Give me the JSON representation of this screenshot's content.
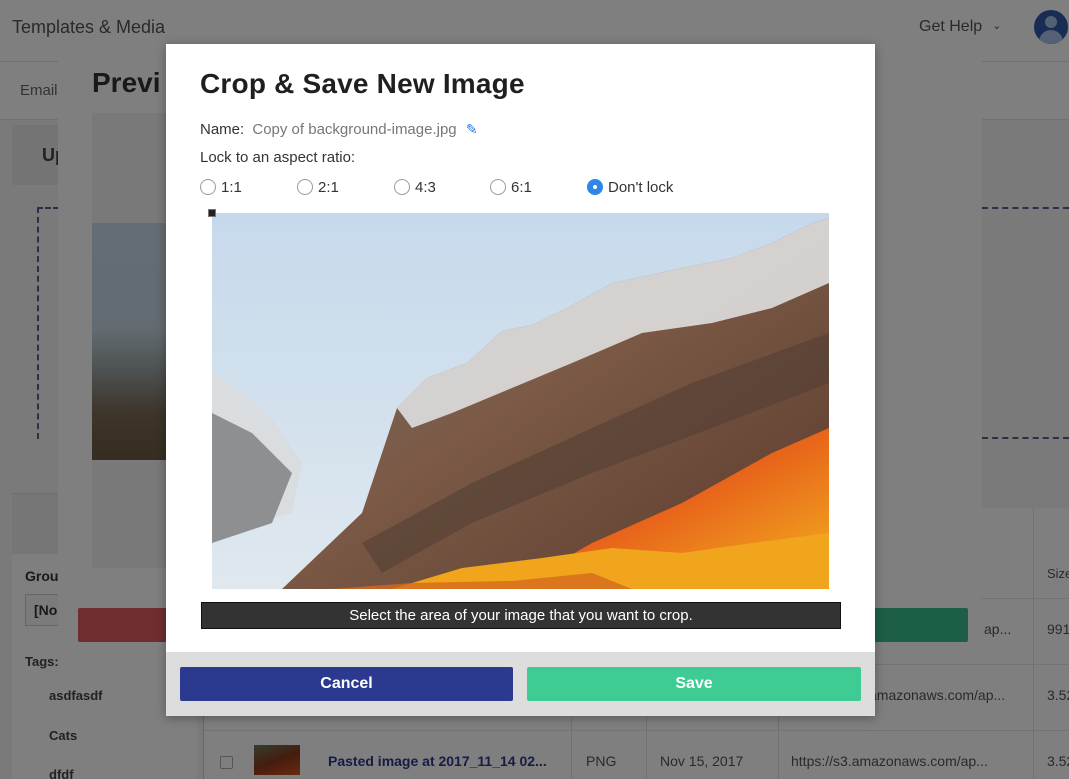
{
  "app": {
    "title": "Templates & Media",
    "help_label": "Get Help",
    "subtab": "Email"
  },
  "background": {
    "panel_title": "Up",
    "group_label": "Grou",
    "group_value": "[No",
    "tags_label": "Tags:",
    "tags": [
      "asdfasdf",
      "Cats",
      "dfdf"
    ],
    "size_header": "Size",
    "rows": [
      {
        "url": "ap...",
        "size": "991"
      },
      {
        "url": "amazonaws.com/ap...",
        "size": "3.52"
      },
      {
        "name": "Pasted image at 2017_11_14 02...",
        "type": "PNG",
        "date": "Nov 15, 2017",
        "url": "https://s3.amazonaws.com/ap...",
        "size": "3.52"
      }
    ]
  },
  "preview_modal": {
    "title": "Previ"
  },
  "crop_modal": {
    "title": "Crop & Save New Image",
    "name_label": "Name:",
    "file_name": "Copy of background-image.jpg",
    "lock_label": "Lock to an aspect ratio:",
    "ratios": [
      {
        "label": "1:1",
        "selected": false
      },
      {
        "label": "2:1",
        "selected": false
      },
      {
        "label": "4:3",
        "selected": false
      },
      {
        "label": "6:1",
        "selected": false
      },
      {
        "label": "Don't lock",
        "selected": true
      }
    ],
    "hint": "Select the area of your image that you want to crop.",
    "cancel_label": "Cancel",
    "save_label": "Save"
  },
  "colors": {
    "primary": "#2b3a8f",
    "success": "#3ecb94",
    "danger": "#e15a61",
    "radio_selected": "#2e86e8"
  }
}
